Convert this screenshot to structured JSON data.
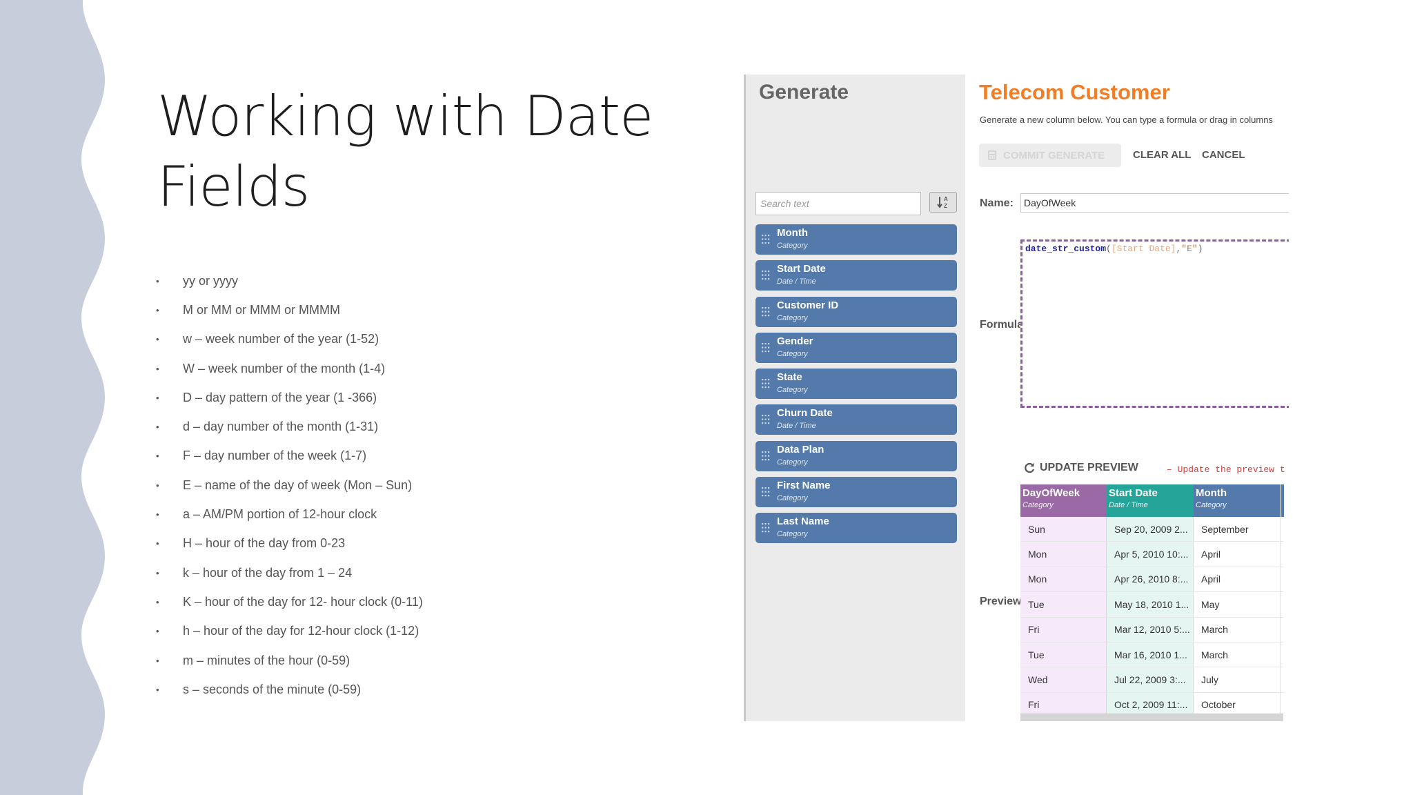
{
  "slide": {
    "title_line1": "Working with Date",
    "title_line2": "Fields",
    "bullets": [
      "yy or yyyy",
      "M or MM or MMM or MMMM",
      "w – week number of the year (1-52)",
      "W – week number of the month (1-4)",
      "D – day pattern of the year (1 -366)",
      "d – day number of the month (1-31)",
      "F – day number of the week (1-7)",
      "E – name of the day of week (Mon – Sun)",
      "a – AM/PM portion of 12-hour clock",
      "H – hour of the day from 0-23",
      "k – hour of the day from 1 – 24",
      "K – hour of the day for 12- hour clock (0-11)",
      "h – hour of the day for 12-hour clock (1-12)",
      "m – minutes of the hour (0-59)",
      "s – seconds of the minute (0-59)"
    ],
    "bullet_char": "•",
    "wave_color": "#c8cddb"
  },
  "generate_panel": {
    "title": "Generate",
    "search_placeholder": "Search text",
    "sort_icon": "sort-alpha-icon",
    "fields": [
      {
        "name": "Month",
        "type": "Category"
      },
      {
        "name": "Start Date",
        "type": "Date / Time"
      },
      {
        "name": "Customer ID",
        "type": "Category"
      },
      {
        "name": "Gender",
        "type": "Category"
      },
      {
        "name": "State",
        "type": "Category"
      },
      {
        "name": "Churn Date",
        "type": "Date / Time"
      },
      {
        "name": "Data Plan",
        "type": "Category"
      },
      {
        "name": "First Name",
        "type": "Category"
      },
      {
        "name": "Last Name",
        "type": "Category"
      }
    ]
  },
  "editor": {
    "title": "Telecom Customer",
    "subtitle": "Generate a new column below.  You can type a formula or drag in columns",
    "commit_label": "COMMIT GENERATE",
    "clear_label": "CLEAR ALL",
    "cancel_label": "CANCEL",
    "name_label": "Name:",
    "name_value": "DayOfWeek",
    "formula_label": "Formula:",
    "formula": {
      "fn": "date_str_custom",
      "open": "(",
      "arg": "[Start Date]",
      "comma": ",",
      "str": "\"E\"",
      "close": ")"
    },
    "preview_label": "Preview:",
    "update_preview_label": "UPDATE PREVIEW",
    "update_note": "–  Update the preview t"
  },
  "preview": {
    "columns": [
      {
        "name": "DayOfWeek",
        "type": "Category",
        "color": "#9b69a6"
      },
      {
        "name": "Start Date",
        "type": "Date / Time",
        "color": "#25a59a"
      },
      {
        "name": "Month",
        "type": "Category",
        "color": "#537aaa"
      }
    ],
    "rows": [
      [
        "Sun",
        "Sep 20, 2009 2...",
        "September"
      ],
      [
        "Mon",
        "Apr 5, 2010 10:...",
        "April"
      ],
      [
        "Mon",
        "Apr 26, 2010 8:...",
        "April"
      ],
      [
        "Tue",
        "May 18, 2010 1...",
        "May"
      ],
      [
        "Fri",
        "Mar 12, 2010 5:...",
        "March"
      ],
      [
        "Tue",
        "Mar 16, 2010 1...",
        "March"
      ],
      [
        "Wed",
        "Jul 22, 2009 3:...",
        "July"
      ],
      [
        "Fri",
        "Oct 2, 2009 11:...",
        "October"
      ]
    ]
  }
}
